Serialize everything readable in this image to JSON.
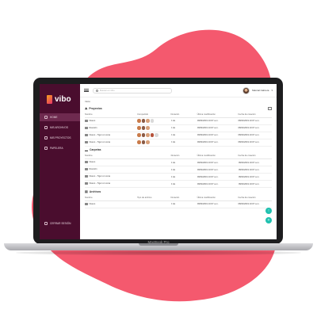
{
  "brand": {
    "logo_text": "vibo",
    "device_label": "MacBook Pro",
    "blob_color": "#f4596e",
    "sidebar_color": "#4a0d2e",
    "accent": "#20c1b0"
  },
  "sidebar": {
    "items": [
      {
        "label": "HOME",
        "icon": "home-icon",
        "active": true
      },
      {
        "label": "MIS ARCHIVOS",
        "icon": "folder-icon",
        "active": false
      },
      {
        "label": "MIS PROYECTOS",
        "icon": "projects-icon",
        "active": false
      },
      {
        "label": "PAPELERA",
        "icon": "trash-icon",
        "active": false
      }
    ],
    "footer_label": "CERRAR SESIÓN"
  },
  "topbar": {
    "search_placeholder": "Buscar en vibo",
    "user_name": "Marcial Cabrera"
  },
  "breadcrumb": "Inicio",
  "projects": {
    "title": "Proyectos",
    "columns": [
      "Nombre",
      "Compartido",
      "Duración",
      "Última modificación",
      "Fecha de creación"
    ],
    "rows": [
      {
        "name": "Nuevo",
        "avatars": 3,
        "extra": true,
        "duration": "0 Hs",
        "modified": "08/04/2019 10:07 a.m.",
        "created": "08/04/2019 10:07 a.m."
      },
      {
        "name": "Reunión",
        "avatars": 3,
        "extra": false,
        "duration": "0 Hs",
        "modified": "08/04/2019 10:07 a.m.",
        "created": "08/04/2019 10:07 a.m."
      },
      {
        "name": "Nuevo - Tiger en cena",
        "avatars": 4,
        "extra": true,
        "duration": "0 Hs",
        "modified": "08/04/2019 10:07 a.m.",
        "created": "08/04/2019 10:07 a.m."
      },
      {
        "name": "Nuevo - Tiger en cena",
        "avatars": 3,
        "extra": false,
        "duration": "0 Hs",
        "modified": "08/04/2019 10:07 a.m.",
        "created": "08/04/2019 10:07 a.m."
      }
    ]
  },
  "folders": {
    "title": "Carpetas",
    "columns": [
      "Nombre",
      "Duración",
      "Última modificación",
      "Fecha de creación"
    ],
    "rows": [
      {
        "name": "Nuevo",
        "duration": "0 Hs",
        "modified": "08/04/2019 10:07 a.m.",
        "created": "08/04/2019 10:07 a.m."
      },
      {
        "name": "Reunión",
        "duration": "0 Hs",
        "modified": "08/04/2019 10:07 a.m.",
        "created": "08/04/2019 10:07 a.m."
      },
      {
        "name": "Nuevo - Tiger en cena",
        "duration": "0 Hs",
        "modified": "08/04/2019 10:07 a.m.",
        "created": "08/04/2019 10:07 a.m."
      },
      {
        "name": "Nuevo - Tiger en cena",
        "duration": "0 Hs",
        "modified": "08/04/2019 10:07 a.m.",
        "created": "08/04/2019 10:07 a.m."
      }
    ]
  },
  "files": {
    "title": "Archivos",
    "columns": [
      "Nombre",
      "Tipo de archivo",
      "Duración",
      "Última modificación",
      "Fecha de creación"
    ],
    "rows": [
      {
        "name": "Nuevo",
        "type": "",
        "duration": "0 Hs",
        "modified": "08/04/2019 10:07 a.m.",
        "created": "08/04/2019 10:07 a.m."
      }
    ]
  },
  "avatar_colors": [
    "#c97b4a",
    "#8a5a44",
    "#d8a07a",
    "#b5523a",
    "#e0c0a8"
  ]
}
